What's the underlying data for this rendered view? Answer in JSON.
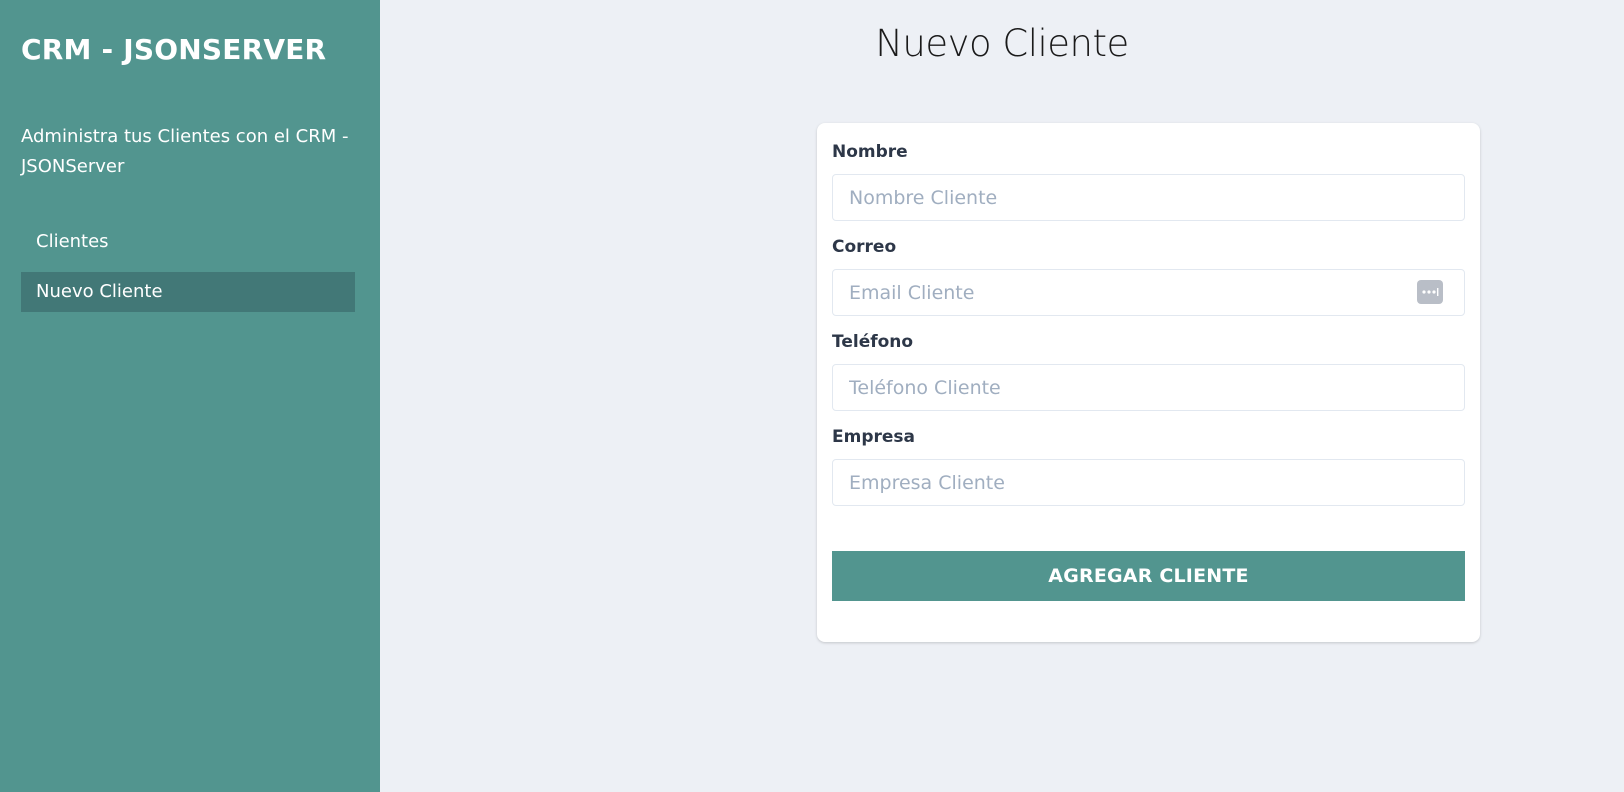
{
  "sidebar": {
    "brand": "CRM - JSONSERVER",
    "tagline": "Administra tus Clientes con el CRM - JSONServer",
    "items": [
      {
        "label": "Clientes",
        "active": false
      },
      {
        "label": "Nuevo Cliente",
        "active": true
      }
    ]
  },
  "main": {
    "title": "Nuevo Cliente",
    "form": {
      "fields": [
        {
          "label": "Nombre",
          "placeholder": "Nombre Cliente",
          "value": ""
        },
        {
          "label": "Correo",
          "placeholder": "Email Cliente",
          "value": "",
          "icon": "password-manager-icon"
        },
        {
          "label": "Teléfono",
          "placeholder": "Teléfono Cliente",
          "value": ""
        },
        {
          "label": "Empresa",
          "placeholder": "Empresa Cliente",
          "value": ""
        }
      ],
      "submit_label": "AGREGAR CLIENTE"
    }
  },
  "colors": {
    "sidebar_bg": "#52958f",
    "active_item_bg": "#427877",
    "main_bg": "#edf0f5",
    "button_bg": "#52958f"
  }
}
